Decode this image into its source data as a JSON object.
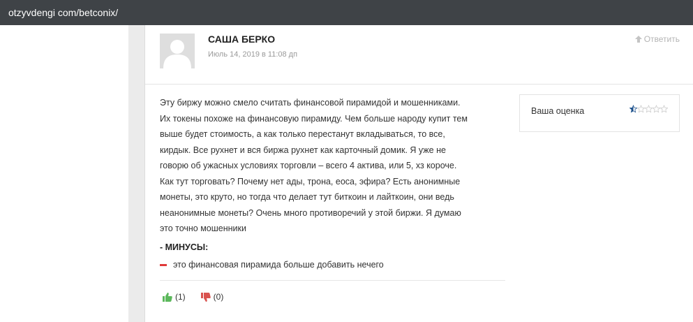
{
  "topbar": {
    "url": "otzyvdengi com/betconix/"
  },
  "review": {
    "author": "САША БЕРКО",
    "date": "Июль 14, 2019 в 11:08 дп",
    "reply_label": "Ответить",
    "body_lines": [
      "Эту биржу можно смело считать финансовой пирамидой и мошенниками.",
      "Их токены похоже на финансовую пирамиду. Чем больше народу купит тем",
      "выше будет стоимость, а как только перестанут вкладываться, то все,",
      "кирдык. Все рухнет и вся биржа рухнет как карточный домик. Я уже не",
      "говорю об ужасных условиях торговли – всего 4 актива, или 5, хз короче.",
      "Как тут торговать? Почему нет ады, трона, еоса, эфира? Есть анонимные",
      "монеты, это круто, но тогда что делает тут биткоин и лайткоин, они ведь",
      "неанонимные монеты? Очень много противоречий у этой биржи. Я думаю",
      "это точно мошенники"
    ],
    "cons_title": "- МИНУСЫ:",
    "cons_item": "это финансовая пирамида больше добавить нечего",
    "likes": "(1)",
    "dislikes": "(0)",
    "rating_label": "Ваша оценка",
    "rating_value": 0.5,
    "rating_max": 5
  },
  "colors": {
    "topbar": "#3f4347",
    "like_icon": "#5cb85c",
    "dislike_icon": "#d9534f",
    "minus_mark": "#e03a3a",
    "star_filled": "#1a4f8b",
    "star_empty": "#c8c8c8"
  },
  "icons": {
    "reply": "arrow-up-icon",
    "like": "thumbs-up-icon",
    "dislike": "thumbs-down-icon",
    "avatar": "user-silhouette-icon"
  }
}
